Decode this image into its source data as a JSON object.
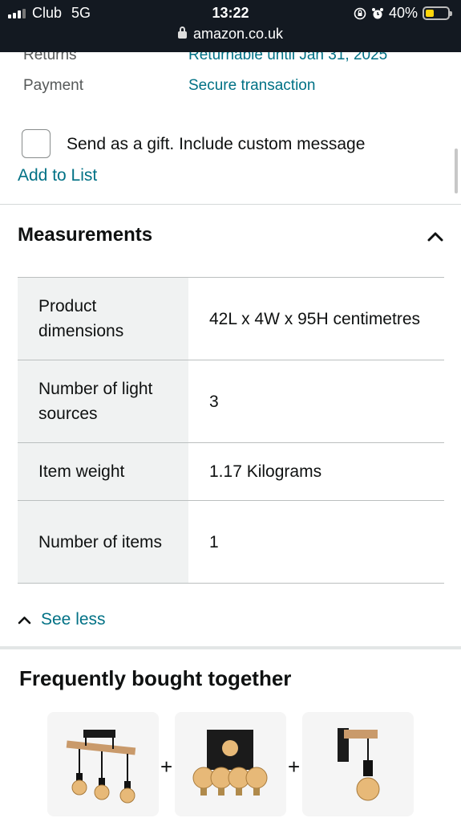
{
  "status_bar": {
    "carrier": "Club",
    "network": "5G",
    "time": "13:22",
    "battery": "40%",
    "battery_level": 0.4,
    "url": "amazon.co.uk"
  },
  "details": {
    "returns_label": "Returns",
    "returns_value": "Returnable until Jan 31, 2025",
    "payment_label": "Payment",
    "payment_value": "Secure transaction"
  },
  "gift": {
    "label": "Send as a gift. Include custom message",
    "checked": false
  },
  "add_to_list": "Add to List",
  "measurements": {
    "title": "Measurements",
    "rows": [
      {
        "key": "Product dimensions",
        "value": "42L x 4W x 95H centimetres"
      },
      {
        "key": "Number of light sources",
        "value": "3"
      },
      {
        "key": "Item weight",
        "value": "1.17 Kilograms"
      },
      {
        "key": "Number of items",
        "value": "1"
      }
    ],
    "see_less": "See less"
  },
  "frequently_bought": {
    "title": "Frequently bought together",
    "plus": "+",
    "products": [
      {
        "name": "ceiling-light-bar-image"
      },
      {
        "name": "vintage-bulbs-pack-image"
      },
      {
        "name": "wall-light-image"
      }
    ]
  },
  "colors": {
    "header_bg": "#131921",
    "link": "#007185",
    "key_cell_bg": "#f0f2f2",
    "battery": "#ffd60a"
  }
}
